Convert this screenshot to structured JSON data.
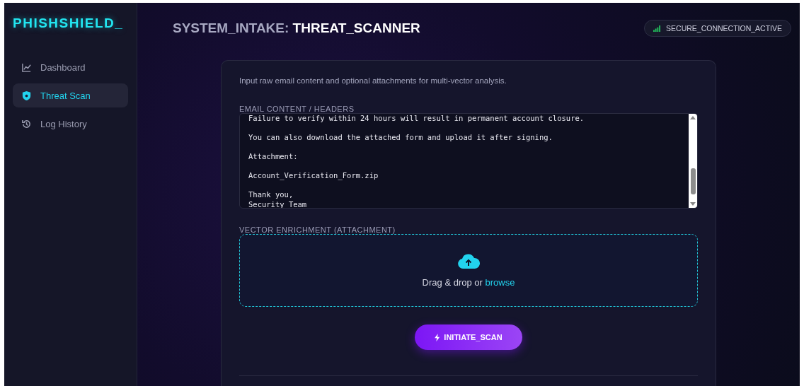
{
  "brand": "PHISHSHIELD_",
  "nav": [
    {
      "label": "Dashboard",
      "kind": "chart",
      "selected": false
    },
    {
      "label": "Threat Scan",
      "kind": "shield",
      "selected": true
    },
    {
      "label": "Log History",
      "kind": "history",
      "selected": false
    }
  ],
  "header": {
    "title_prefix": "SYSTEM_INTAKE:",
    "title": "THREAT_SCANNER",
    "status": "SECURE_CONNECTION_ACTIVE"
  },
  "intro": "Input raw email content and optional attachments for multi-vector analysis.",
  "email_field": {
    "label": "EMAIL CONTENT / HEADERS",
    "value": "Failure to verify within 24 hours will result in permanent account closure.\n\nYou can also download the attached form and upload it after signing.\n\nAttachment:\n\nAccount_Verification_Form.zip\n\nThank you,\nSecurity Team"
  },
  "attachment": {
    "label": "VECTOR ENRICHMENT (ATTACHMENT)",
    "prompt": "Drag & drop or",
    "link": "browse"
  },
  "scan_button": "INITIATE_SCAN"
}
